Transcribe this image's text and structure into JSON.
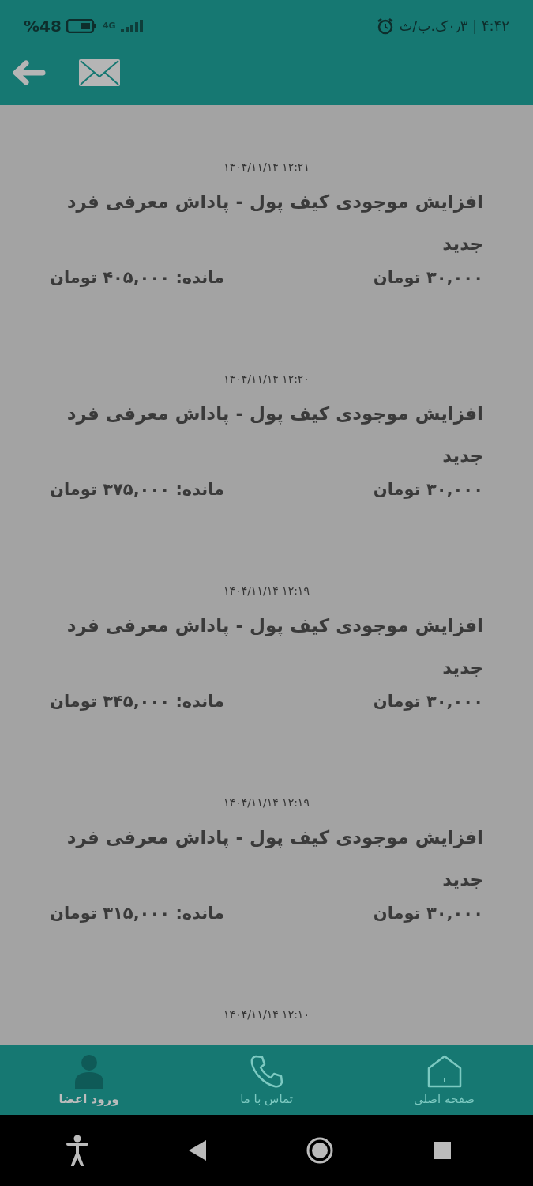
{
  "status_bar": {
    "time": "۴:۴۲ | ۰٫۳ک.ب/ث",
    "battery": "%48",
    "network": "4G"
  },
  "transactions": [
    {
      "date": "۱۴۰۴/۱۱/۱۴ ۱۲:۲۱",
      "title": "افزایش  موجودی کیف  پول - پاداش  معرفی فرد جدید",
      "amount": "۳۰,۰۰۰ تومان",
      "balance": "مانده: ۴۰۵,۰۰۰ تومان"
    },
    {
      "date": "۱۴۰۴/۱۱/۱۴ ۱۲:۲۰",
      "title": "افزایش  موجودی کیف  پول - پاداش  معرفی فرد جدید",
      "amount": "۳۰,۰۰۰ تومان",
      "balance": "مانده: ۳۷۵,۰۰۰ تومان"
    },
    {
      "date": "۱۴۰۴/۱۱/۱۴ ۱۲:۱۹",
      "title": "افزایش  موجودی کیف  پول - پاداش  معرفی فرد جدید",
      "amount": "۳۰,۰۰۰ تومان",
      "balance": "مانده: ۳۴۵,۰۰۰ تومان"
    },
    {
      "date": "۱۴۰۴/۱۱/۱۴ ۱۲:۱۹",
      "title": "افزایش  موجودی کیف  پول - پاداش  معرفی فرد جدید",
      "amount": "۳۰,۰۰۰ تومان",
      "balance": "مانده: ۳۱۵,۰۰۰ تومان"
    },
    {
      "date": "۱۴۰۴/۱۱/۱۴ ۱۲:۱۰"
    }
  ],
  "bottom_nav": [
    {
      "kind": "home",
      "label": "صفحه اصلی",
      "selected": false
    },
    {
      "kind": "phone",
      "label": "تماس با ما",
      "selected": false
    },
    {
      "kind": "user",
      "label": "ورود اعضا",
      "selected": true
    }
  ]
}
